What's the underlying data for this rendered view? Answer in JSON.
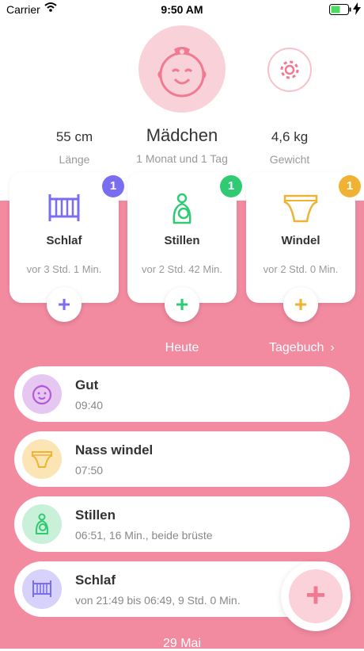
{
  "status_bar": {
    "carrier": "Carrier",
    "time": "9:50 AM"
  },
  "profile": {
    "length": {
      "value": "55 cm",
      "label": "Länge"
    },
    "name": {
      "value": "Mädchen",
      "label": "1 Monat und 1 Tag"
    },
    "weight": {
      "value": "4,6 kg",
      "label": "Gewicht"
    }
  },
  "cards": [
    {
      "title": "Schlaf",
      "time": "vor 3 Std. 1 Min.",
      "badge": "1",
      "add": "+",
      "color": "#7b6df2"
    },
    {
      "title": "Stillen",
      "time": "vor 2 Std. 42 Min.",
      "badge": "1",
      "add": "+",
      "color": "#2fcb72"
    },
    {
      "title": "Windel",
      "time": "vor 2 Std. 0 Min.",
      "badge": "1",
      "add": "+",
      "color": "#f0b233"
    }
  ],
  "timeline": {
    "heute": "Heute",
    "tagebuch": "Tagebuch",
    "chevron": "›",
    "entries": [
      {
        "title": "Gut",
        "subtitle": "09:40",
        "icon": "baby-face-icon"
      },
      {
        "title": "Nass windel",
        "subtitle": "07:50",
        "icon": "diaper-icon"
      },
      {
        "title": "Stillen",
        "subtitle": "06:51, 16 Min., beide brüste",
        "icon": "nursing-icon"
      },
      {
        "title": "Schlaf",
        "subtitle": "von 21:49 bis 06:49, 9 Std. 0 Min.",
        "icon": "crib-icon"
      }
    ],
    "date": "29 Mai"
  },
  "fab": {
    "label": "+"
  },
  "colors": {
    "accent": "#f28aa0",
    "sleep": "#7b6df2",
    "nursing": "#2fcb72",
    "diaper": "#f0b233"
  }
}
